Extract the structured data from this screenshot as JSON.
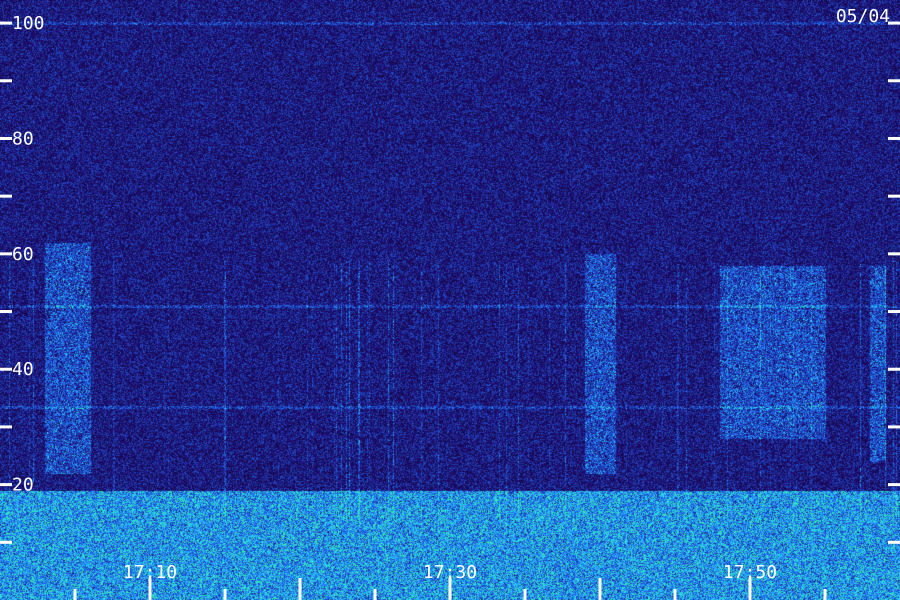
{
  "chart_data": {
    "type": "heatmap",
    "title": "",
    "date_label": "05/04",
    "xlabel": "",
    "ylabel": "",
    "ylim": [
      0,
      104
    ],
    "xlim_minutes": [
      "17:00",
      "18:00"
    ],
    "y_tick_labels": [
      {
        "value": 100,
        "label": "100"
      },
      {
        "value": 80,
        "label": "80"
      },
      {
        "value": 60,
        "label": "60"
      },
      {
        "value": 40,
        "label": "40"
      },
      {
        "value": 20,
        "label": "20"
      }
    ],
    "y_minor_ticks": [
      90,
      70,
      50,
      30,
      10
    ],
    "x_tick_labels": [
      {
        "time": "17:10",
        "label": "17:10"
      },
      {
        "time": "17:30",
        "label": "17:30"
      },
      {
        "time": "17:50",
        "label": "17:50"
      }
    ],
    "x_major_ticks": [
      "17:10",
      "17:20",
      "17:30",
      "17:40",
      "17:50"
    ],
    "x_minor_ticks": [
      "17:05",
      "17:15",
      "17:25",
      "17:35",
      "17:45",
      "17:55"
    ],
    "features": {
      "horizontal_lines": [
        100,
        33.5,
        51
      ],
      "broadband_bursts": [
        {
          "start": "17:03",
          "end": "17:06",
          "ymin": 22,
          "ymax": 62
        },
        {
          "start": "17:39",
          "end": "17:41",
          "ymin": 22,
          "ymax": 60
        },
        {
          "start": "17:58",
          "end": "17:59",
          "ymin": 24,
          "ymax": 58
        },
        {
          "start": "17:48",
          "end": "17:55",
          "ymin": 28,
          "ymax": 58
        }
      ],
      "low_frequency_noise_below": 19
    },
    "colors": {
      "background": "#1a0a5c",
      "mid": "#2c2cd4",
      "high": "#3a8cff",
      "peak": "#2ee8b0"
    }
  }
}
